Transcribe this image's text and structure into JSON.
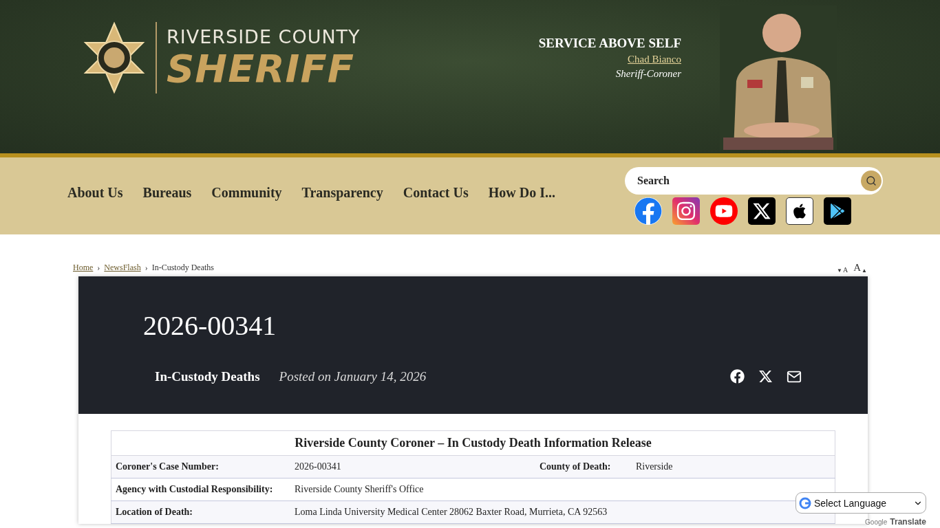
{
  "header": {
    "logo": {
      "line1": "RIVERSIDE COUNTY",
      "line2": "SHERIFF"
    },
    "motto": "SERVICE ABOVE SELF",
    "name_link": "Chad Bianco",
    "role": "Sheriff-Coroner"
  },
  "nav": {
    "items": [
      {
        "label": "About Us"
      },
      {
        "label": "Bureaus"
      },
      {
        "label": "Community"
      },
      {
        "label": "Transparency"
      },
      {
        "label": "Contact Us"
      },
      {
        "label": "How Do I..."
      }
    ]
  },
  "search": {
    "placeholder": "Search"
  },
  "social": [
    {
      "kind": "facebook"
    },
    {
      "kind": "instagram"
    },
    {
      "kind": "youtube"
    },
    {
      "kind": "x"
    },
    {
      "kind": "apple"
    },
    {
      "kind": "play"
    }
  ],
  "breadcrumb": [
    {
      "label": "Home",
      "link": true
    },
    {
      "separator": "›",
      "label": "NewsFlash",
      "link": true
    },
    {
      "separator": "›",
      "label": "In-Custody Deaths",
      "link": false
    }
  ],
  "font_size": [
    {
      "kind": "decrease",
      "caret": "▼",
      "label": "A"
    },
    {
      "kind": "increase",
      "caret": "▲",
      "label": "A"
    }
  ],
  "article": {
    "title": "2026-00341",
    "category": "In-Custody Deaths",
    "posted": "Posted on January 14, 2026",
    "share": [
      {
        "kind": "facebook"
      },
      {
        "kind": "x"
      },
      {
        "kind": "email"
      }
    ]
  },
  "table": {
    "title": "Riverside County Coroner – In Custody Death Information Release",
    "rows": [
      {
        "cells": [
          {
            "label": "Coroner's Case Number:",
            "value": "2026-00341"
          },
          {
            "label": "County of Death:",
            "value": "Riverside"
          }
        ]
      },
      {
        "cells": [
          {
            "label": "Agency with Custodial Responsibility:",
            "value": "Riverside County Sheriff's Office"
          }
        ]
      },
      {
        "cells": [
          {
            "label": "Location of Death:",
            "value": "Loma Linda University Medical Center 28062 Baxter Road, Murrieta, CA 92563"
          }
        ]
      }
    ]
  },
  "translate": {
    "select": "Select Language",
    "brand": "Google",
    "powered": "Translate"
  }
}
